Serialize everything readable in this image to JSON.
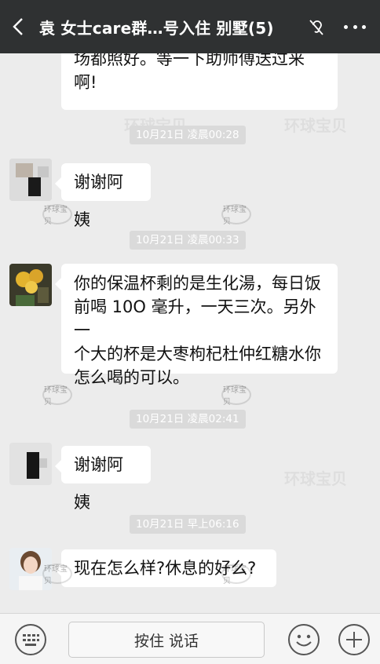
{
  "header": {
    "title": "袁 女士care群…号入住 别墅(5)",
    "back_icon": "chevron-left-icon",
    "mute_icon": "mute-ear-icon",
    "more_icon": "more-dots-icon"
  },
  "watermarks": [
    "环球宝贝",
    "环球宝贝",
    "环球宝贝"
  ],
  "watermark_badge": "环球宝贝",
  "messages": {
    "m1": {
      "lines": [
        "场都照好。等一下助师傅送过来",
        "啊!"
      ]
    },
    "t1": "10月21日 凌晨00:28",
    "m2": {
      "text": "谢谢阿姨"
    },
    "t2": "10月21日 凌晨00:33",
    "m3": {
      "lines": [
        "你的保温杯剩的是生化湯，每日饭",
        "前喝 10O 毫升，一天三次。另外一",
        "个大的杯是大枣枸杞杜仲红糖水你",
        "怎么喝的可以。"
      ]
    },
    "t3": "10月21日 凌晨02:41",
    "m4": {
      "text": "谢谢阿姨"
    },
    "t4": "10月21日 早上06:16",
    "m5": {
      "text": "现在怎么样?休息的好么?"
    }
  },
  "footer": {
    "talk_label": "按住 说话",
    "keyboard_icon": "keyboard-icon",
    "emoji_icon": "emoji-icon",
    "plus_icon": "plus-icon"
  },
  "colors": {
    "titlebar": "#2f3132",
    "chat_bg": "#ececec",
    "timestamp_bg": "#dadada",
    "bubble": "#ffffff"
  }
}
